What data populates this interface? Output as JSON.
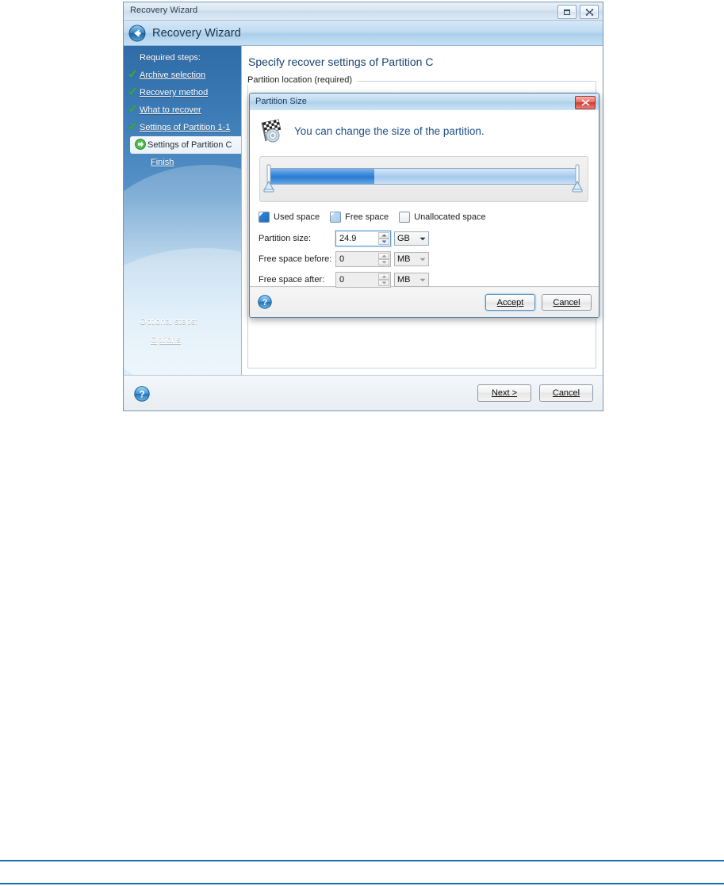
{
  "window": {
    "titlebar_text": "Recovery Wizard",
    "header_title": "Recovery Wizard",
    "back_icon": "back-arrow-icon",
    "restore_button": "restore-window-icon",
    "close_button": "close-window-icon"
  },
  "sidebar": {
    "required_heading": "Required steps:",
    "optional_heading": "Optional steps:",
    "steps": [
      {
        "label": "Archive selection",
        "state": "done",
        "mark": "green-check-icon"
      },
      {
        "label": "Recovery method",
        "state": "done",
        "mark": "green-check-icon"
      },
      {
        "label": "What to recover",
        "state": "done",
        "mark": "green-check-icon"
      },
      {
        "label": "Settings of Partition 1-1",
        "state": "done",
        "mark": "green-check-icon"
      },
      {
        "label": "Settings of Partition C",
        "state": "current",
        "mark": "green-arrow-icon"
      },
      {
        "label": "Finish",
        "state": "pending",
        "mark": "none"
      }
    ],
    "optional_steps": [
      {
        "label": "Options",
        "state": "pending",
        "mark": "none"
      }
    ]
  },
  "main": {
    "page_title": "Specify recover settings of Partition C",
    "group_legend": "Partition location (required)"
  },
  "modal": {
    "title": "Partition Size",
    "close_icon": "close-dialog-icon",
    "flag_icon": "checkered-flag-icon",
    "headline": "You can change the size of the partition.",
    "slider": {
      "used_percent": 34,
      "free_percent": 66,
      "unallocated_percent": 0,
      "left_handle_icon": "slider-handle-left-icon",
      "right_handle_icon": "slider-handle-right-icon"
    },
    "legend": [
      {
        "label": "Used space",
        "swatch": "used",
        "color": "#2c7ad0"
      },
      {
        "label": "Free space",
        "swatch": "free",
        "color": "#b1d2f1"
      },
      {
        "label": "Unallocated space",
        "swatch": "unalloc",
        "color": "#f2f2f2"
      }
    ],
    "fields": [
      {
        "label": "Partition size:",
        "value": "24.9",
        "unit": "GB",
        "enabled": true,
        "focused": true
      },
      {
        "label": "Free space before:",
        "value": "0",
        "unit": "MB",
        "enabled": false,
        "focused": false
      },
      {
        "label": "Free space after:",
        "value": "0",
        "unit": "MB",
        "enabled": false,
        "focused": false
      }
    ],
    "help_icon": "help-icon",
    "accept_label": "Accept",
    "accept_accel": "A",
    "cancel_label": "Cancel",
    "cancel_accel": "C"
  },
  "footer": {
    "help_icon": "help-icon",
    "next_label": "Next >",
    "next_accel": "N",
    "cancel_label": "Cancel",
    "cancel_accel": "C"
  },
  "colors": {
    "accent_blue": "#16416e",
    "sidebar_top": "#2f6ca8",
    "used_space": "#2c7ad0",
    "free_space": "#b1d2f1",
    "rule": "#1a6fae"
  }
}
